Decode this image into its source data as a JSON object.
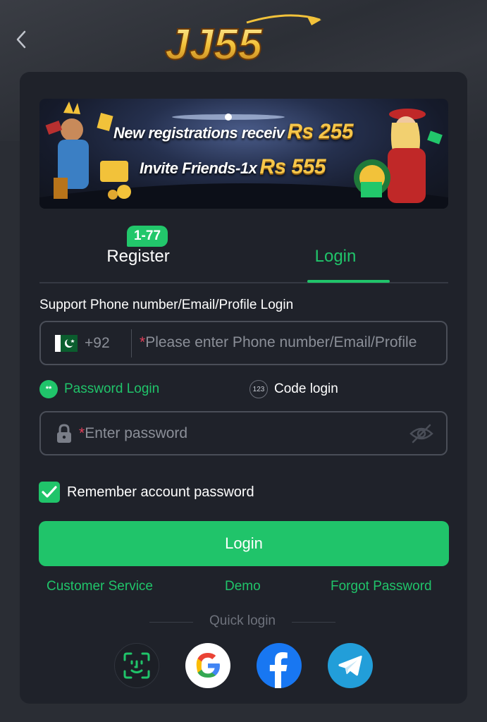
{
  "logo": {
    "text": "JJ55"
  },
  "banner": {
    "line1": "New registrations receiv",
    "line1_amount": "Rs 255",
    "line2": "Invite Friends-1x",
    "line2_amount": "Rs 555"
  },
  "tabs": {
    "register": "Register",
    "register_badge": "1-77",
    "login": "Login",
    "active": "login"
  },
  "form": {
    "account_label": "Support Phone number/Email/Profile Login",
    "country_code": "+92",
    "account_placeholder": "Please enter Phone number/Email/Profile",
    "password_mode": "Password Login",
    "password_mode_icon_text": "**",
    "code_mode": "Code login",
    "code_mode_icon_text": "123",
    "password_placeholder": "Enter password",
    "required_mark": "*",
    "remember_label": "Remember account password",
    "remember_checked": true,
    "submit_label": "Login"
  },
  "links": {
    "customer_service": "Customer Service",
    "demo": "Demo",
    "forgot_password": "Forgot Password"
  },
  "quick_login": {
    "label": "Quick login",
    "providers": [
      "face-id",
      "google",
      "facebook",
      "telegram"
    ]
  },
  "colors": {
    "accent": "#20c46a",
    "background": "#2a2d34",
    "card": "#1f222a",
    "banner_amount": "#f6c64a"
  }
}
